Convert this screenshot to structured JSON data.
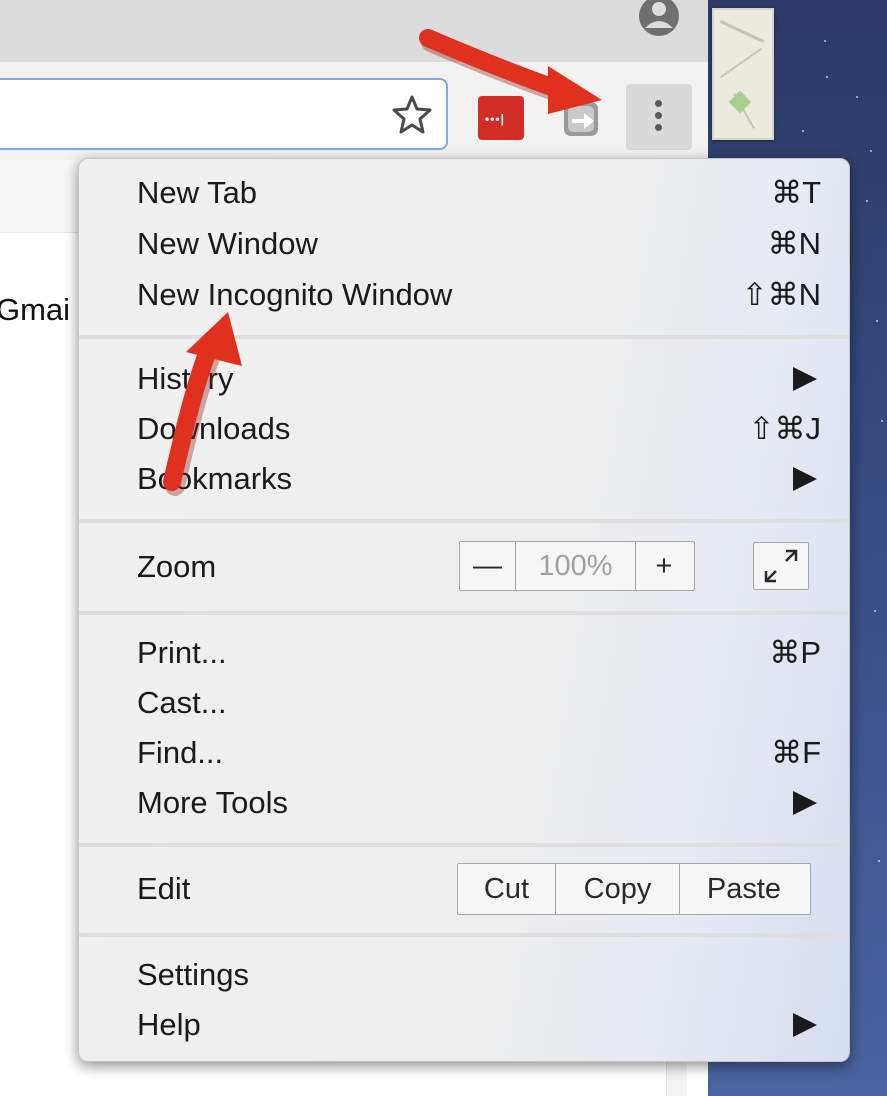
{
  "page": {
    "partial_text": "Gmai"
  },
  "toolbar": {
    "bookmark_icon": "star-icon",
    "extensions": [
      "lastpass-icon",
      "extension-icon"
    ],
    "menu_icon": "kebab-icon"
  },
  "menu": {
    "group1": [
      {
        "label": "New Tab",
        "shortcut": "⌘T"
      },
      {
        "label": "New Window",
        "shortcut": "⌘N"
      },
      {
        "label": "New Incognito Window",
        "shortcut": "⇧⌘N"
      }
    ],
    "group2": [
      {
        "label": "History",
        "shortcut": "",
        "submenu": true
      },
      {
        "label": "Downloads",
        "shortcut": "⇧⌘J"
      },
      {
        "label": "Bookmarks",
        "shortcut": "",
        "submenu": true
      }
    ],
    "zoom": {
      "label": "Zoom",
      "minus": "—",
      "value": "100%",
      "plus": "+"
    },
    "group4": [
      {
        "label": "Print...",
        "shortcut": "⌘P"
      },
      {
        "label": "Cast...",
        "shortcut": ""
      },
      {
        "label": "Find...",
        "shortcut": "⌘F"
      },
      {
        "label": "More Tools",
        "shortcut": "",
        "submenu": true
      }
    ],
    "edit": {
      "label": "Edit",
      "cut": "Cut",
      "copy": "Copy",
      "paste": "Paste"
    },
    "group6": [
      {
        "label": "Settings",
        "shortcut": ""
      },
      {
        "label": "Help",
        "shortcut": "",
        "submenu": true
      }
    ]
  },
  "colors": {
    "annotation_arrow": "#e0301e",
    "menu_bg": "#efefef",
    "omnibox_focus": "#7fa9e6",
    "lastpass": "#d32d27"
  }
}
